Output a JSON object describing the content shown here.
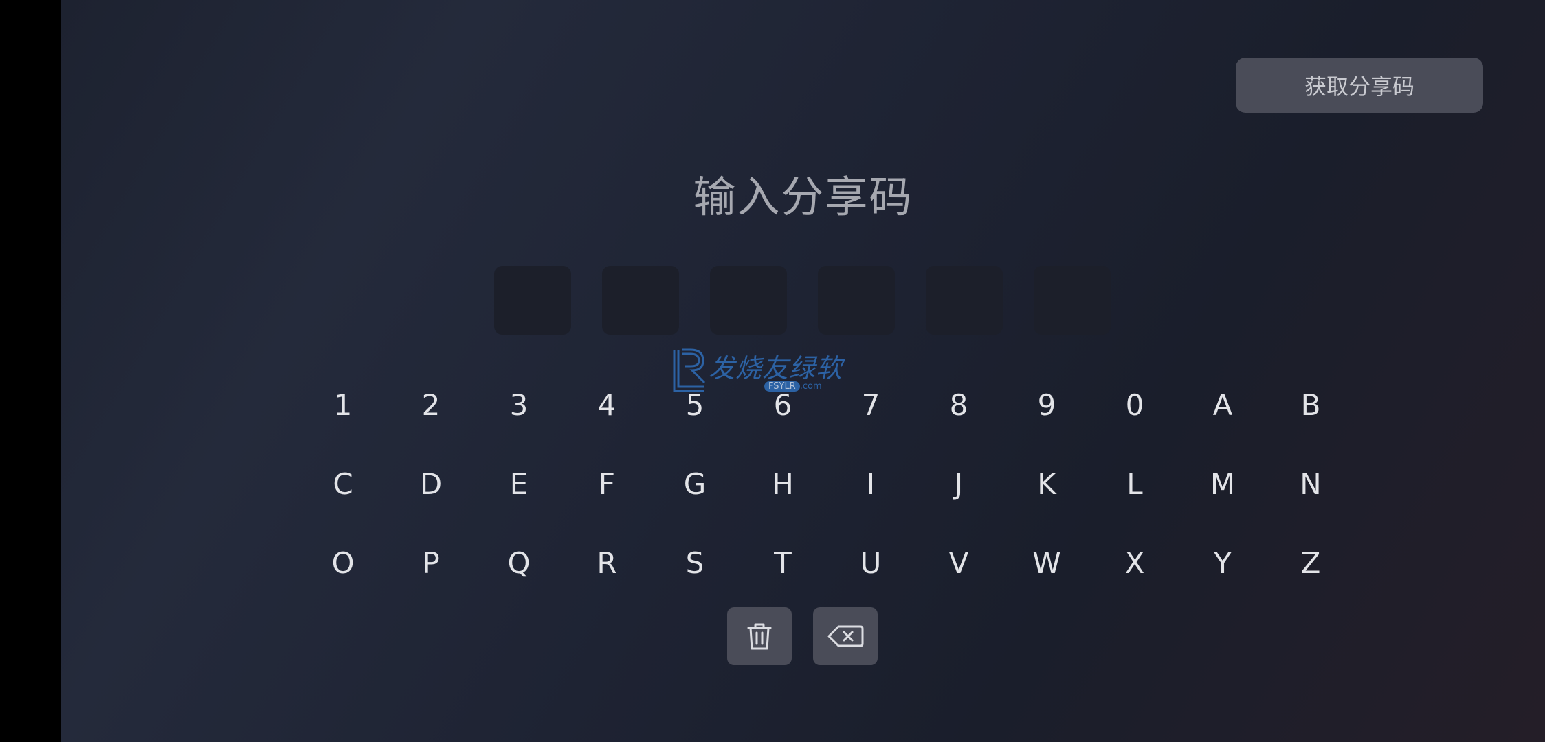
{
  "header": {
    "share_button_label": "获取分享码"
  },
  "main": {
    "title": "输入分享码",
    "code_slots": [
      "",
      "",
      "",
      "",
      "",
      ""
    ]
  },
  "keyboard": {
    "rows": [
      [
        "1",
        "2",
        "3",
        "4",
        "5",
        "6",
        "7",
        "8",
        "9",
        "0",
        "A",
        "B"
      ],
      [
        "C",
        "D",
        "E",
        "F",
        "G",
        "H",
        "I",
        "J",
        "K",
        "L",
        "M",
        "N"
      ],
      [
        "O",
        "P",
        "Q",
        "R",
        "S",
        "T",
        "U",
        "V",
        "W",
        "X",
        "Y",
        "Z"
      ]
    ],
    "actions": [
      {
        "name": "clear-button",
        "icon": "trash-icon"
      },
      {
        "name": "backspace-button",
        "icon": "backspace-icon"
      }
    ]
  },
  "watermark": {
    "text": "发烧友绿软",
    "sub_pill": "FSYLR",
    "sub_suffix": ".com"
  },
  "colors": {
    "background": "#1e2333",
    "button": "#4a4c58",
    "key_text": "#e3e4e8",
    "title_text": "#a6a8b0",
    "code_box": "#1c1f2a",
    "watermark": "#2f6db8"
  }
}
